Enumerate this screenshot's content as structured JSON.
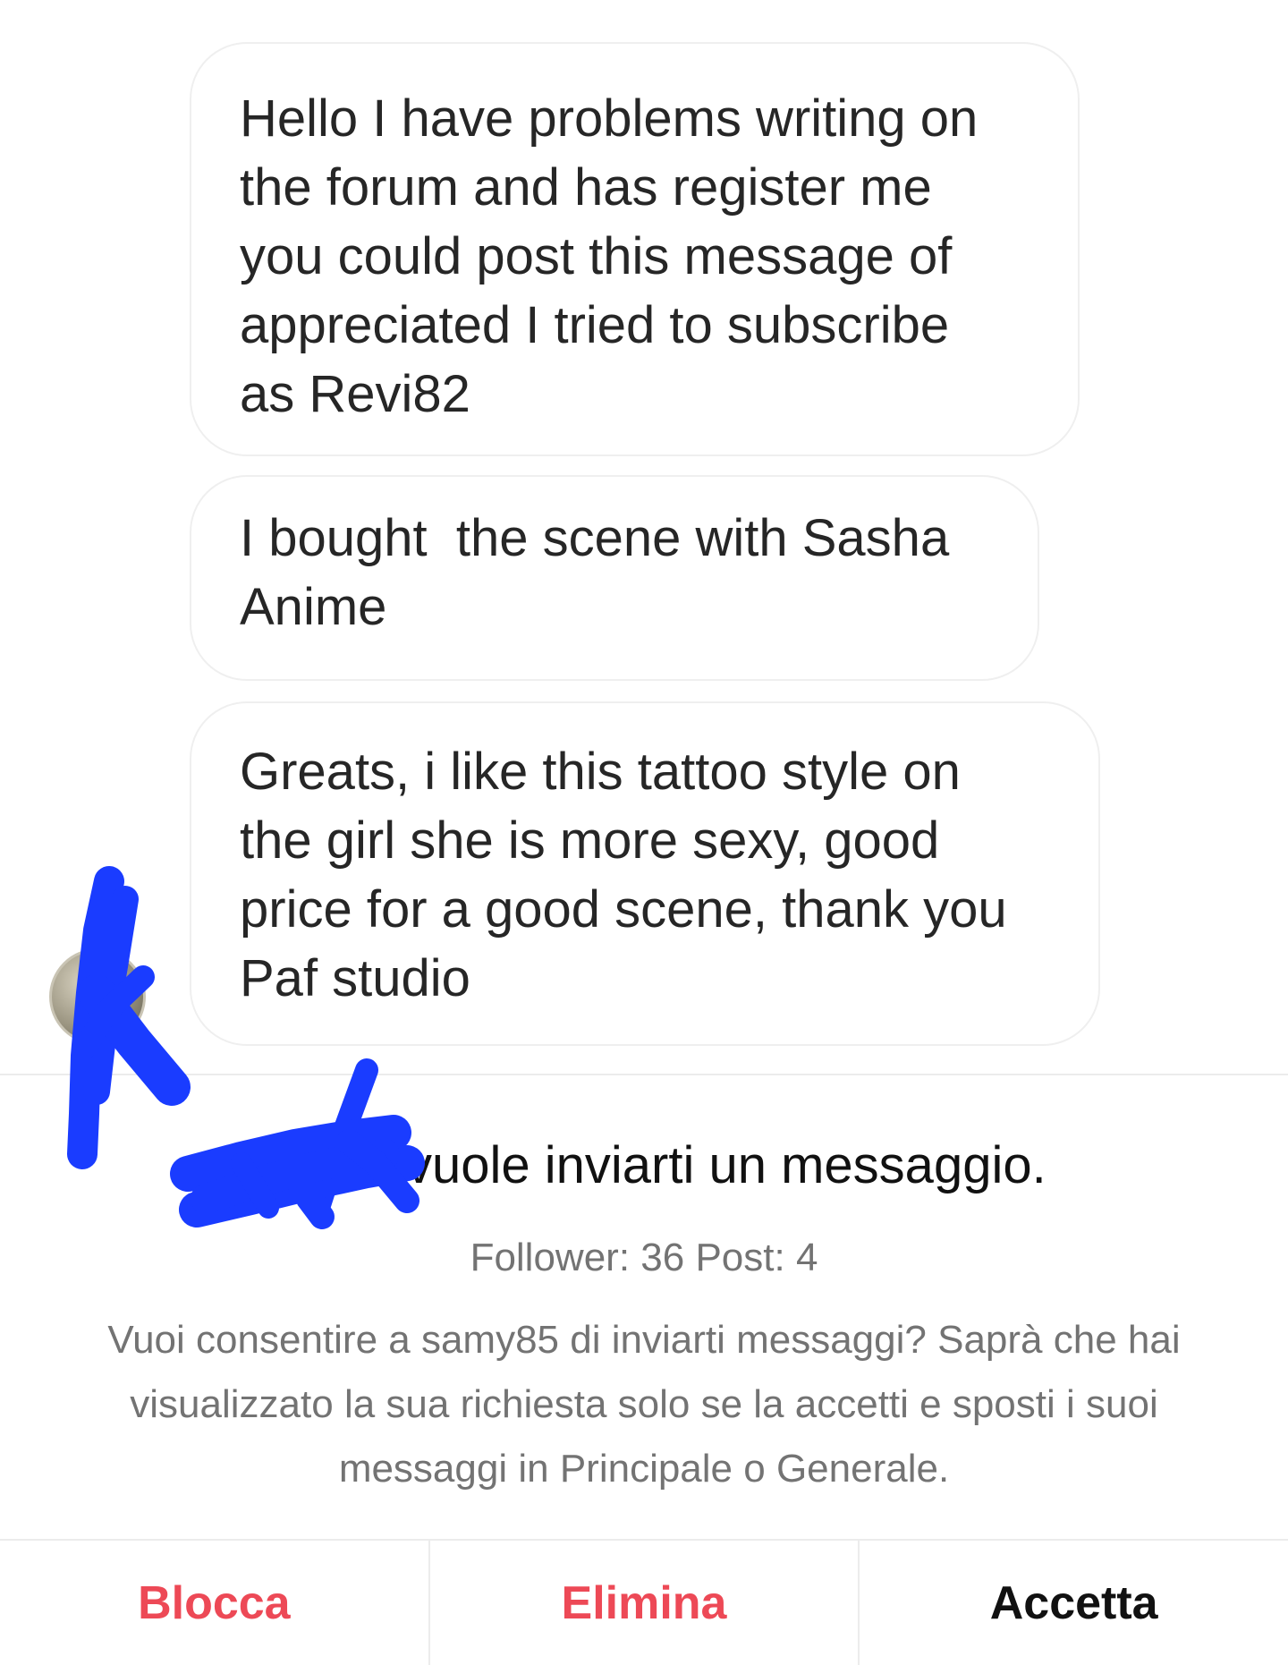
{
  "thread": {
    "messages": [
      {
        "lines": [
          "Hello I have problems writing on",
          "the forum and has register me",
          "you could post this message of",
          "appreciated I tried to subscribe",
          "as Revi82"
        ]
      },
      {
        "lines": [
          "I bought  the scene with Sasha",
          "Anime"
        ]
      },
      {
        "lines": [
          "Greats, i like this tattoo style on",
          "the girl she is more sexy, good",
          "price for a good scene, thank you",
          "Paf studio"
        ]
      }
    ]
  },
  "request": {
    "headline": "vuole inviarti un messaggio.",
    "stats": "Follower: 36 Post: 4",
    "explanation_lines": [
      "Vuoi consentire a samy85 di inviarti messaggi? Saprà che hai",
      "visualizzato la sua richiesta solo se la accetti e sposti i suoi",
      "messaggi in Principale o Generale."
    ]
  },
  "actions": {
    "block_label": "Blocca",
    "delete_label": "Elimina",
    "accept_label": "Accetta"
  },
  "colors": {
    "danger": "#ed4956",
    "scribble": "#1a3cff",
    "secondary_text": "#737373"
  }
}
